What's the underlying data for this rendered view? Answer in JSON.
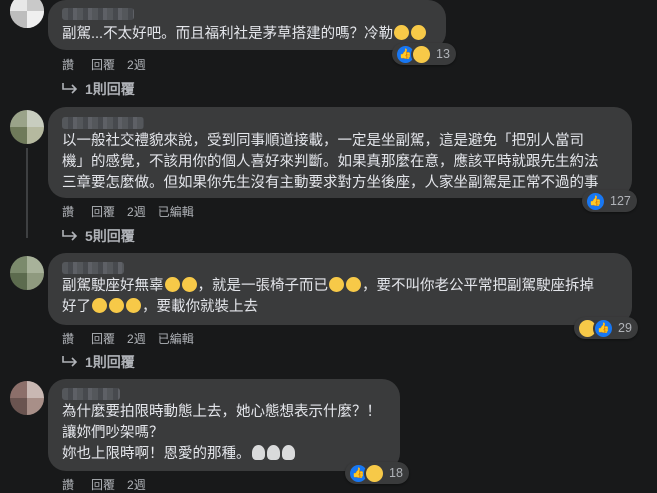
{
  "comments": [
    {
      "lines": [
        "副駕...不太好吧。而且福利社是茅草搭建的嗎？冷勒"
      ],
      "actions": {
        "like": "讚",
        "reply": "回覆",
        "time": "2週",
        "edited": ""
      },
      "reactions": {
        "count": "13"
      },
      "replies": "1則回覆"
    },
    {
      "lines": [
        "以一般社交禮貌來說，受到同事順道接載，一定是坐副駕，這是避免「把別人當司",
        "機」的感覺，不該用你的個人喜好來判斷。如果真那麼在意，應該平時就跟先生約法",
        "三章要怎麼做。但如果你先生沒有主動要求對方坐後座，人家坐副駕是正常不過的事"
      ],
      "actions": {
        "like": "讚",
        "reply": "回覆",
        "time": "2週",
        "edited": "已編輯"
      },
      "reactions": {
        "count": "127"
      },
      "replies": "5則回覆"
    },
    {
      "lines": [
        "副駕駛座好無辜",
        "，就是一張椅子而已",
        "，要不叫你老公平常把副駕駛座拆掉",
        "好了",
        "，要載你就裝上去"
      ],
      "actions": {
        "like": "讚",
        "reply": "回覆",
        "time": "2週",
        "edited": "已編輯"
      },
      "reactions": {
        "count": "29"
      },
      "replies": "1則回覆"
    },
    {
      "lines": [
        "為什麼要拍限時動態上去，她心態想表示什麼？！",
        "讓妳們吵架嗎？",
        "妳也上限時啊！恩愛的那種。"
      ],
      "actions": {
        "like": "讚",
        "reply": "回覆",
        "time": "2週",
        "edited": ""
      },
      "reactions": {
        "count": "18"
      }
    }
  ]
}
